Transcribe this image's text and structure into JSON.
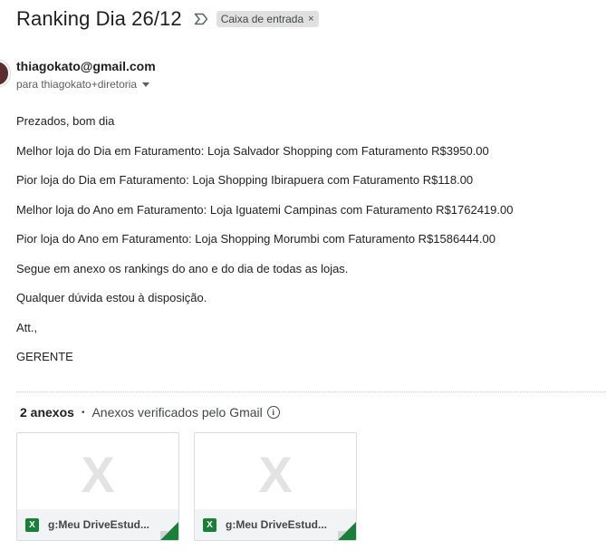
{
  "email": {
    "subject": "Ranking Dia 26/12",
    "label": "Caixa de entrada",
    "label_remove": "×",
    "sender": "thiagokato@gmail.com",
    "recipient": "para thiagokato+diretoria"
  },
  "body": {
    "lines": [
      "Prezados, bom dia",
      "Melhor loja do Dia em Faturamento: Loja Salvador Shopping com Faturamento R$3950.00",
      "Pior loja do Dia em Faturamento: Loja Shopping Ibirapuera com Faturamento R$118.00",
      "Melhor loja do Ano em Faturamento: Loja Iguatemi Campinas com Faturamento R$1762419.00",
      "Pior loja do Ano em Faturamento: Loja Shopping Morumbi com Faturamento R$1586444.00",
      "Segue em anexo os rankings do ano e do dia de todas as lojas.",
      "Qualquer dúvida estou à disposição.",
      "Att.,",
      "GERENTE"
    ]
  },
  "attachments": {
    "count_label": "2 anexos",
    "separator": "•",
    "verified_label": "Anexos verificados pelo Gmail",
    "items": [
      {
        "name": "g:Meu DriveEstud...",
        "preview_glyph": "X",
        "type_glyph": "X"
      },
      {
        "name": "g:Meu DriveEstud...",
        "preview_glyph": "X",
        "type_glyph": "X"
      }
    ]
  },
  "colors": {
    "excel_green": "#188038",
    "label_chip_bg": "#e0e0e0"
  }
}
